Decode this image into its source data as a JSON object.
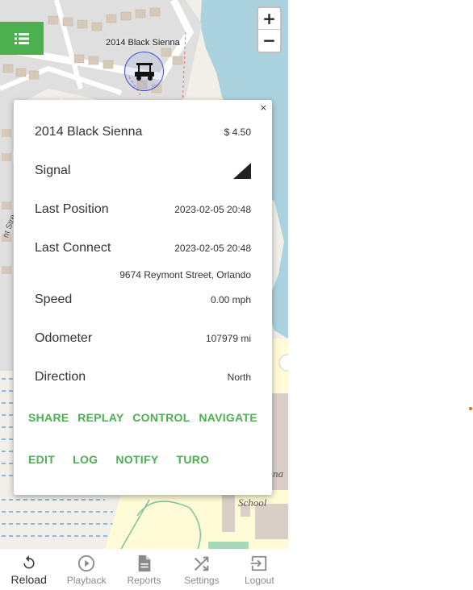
{
  "map": {
    "zoom_in": "+",
    "zoom_out": "−",
    "marker_label": "2014 Black Sienna",
    "street_fragment": "nt Stre",
    "place_label_1": "na",
    "place_label_2": "School"
  },
  "popup": {
    "close": "×",
    "title": "2014 Black Sienna",
    "price": "$ 4.50",
    "signal_label": "Signal",
    "last_position_label": "Last Position",
    "last_position_value": "2023-02-05 20:48",
    "last_connect_label": "Last Connect",
    "last_connect_value": "2023-02-05 20:48",
    "address": "9674 Reymont Street, Orlando",
    "speed_label": "Speed",
    "speed_value": "0.00 mph",
    "odometer_label": "Odometer",
    "odometer_value": "107979 mi",
    "direction_label": "Direction",
    "direction_value": "North",
    "actions_row1": [
      "SHARE",
      "REPLAY",
      "CONTROL",
      "NAVIGATE"
    ],
    "actions_row2": [
      "EDIT",
      "LOG",
      "NOTIFY",
      "TURO"
    ],
    "accent_color": "#4caf50"
  },
  "nav": {
    "items": [
      {
        "label": "Reload",
        "icon": "reload-icon"
      },
      {
        "label": "Playback",
        "icon": "play-icon"
      },
      {
        "label": "Reports",
        "icon": "document-icon"
      },
      {
        "label": "Settings",
        "icon": "shuffle-icon"
      },
      {
        "label": "Logout",
        "icon": "logout-icon"
      }
    ]
  }
}
